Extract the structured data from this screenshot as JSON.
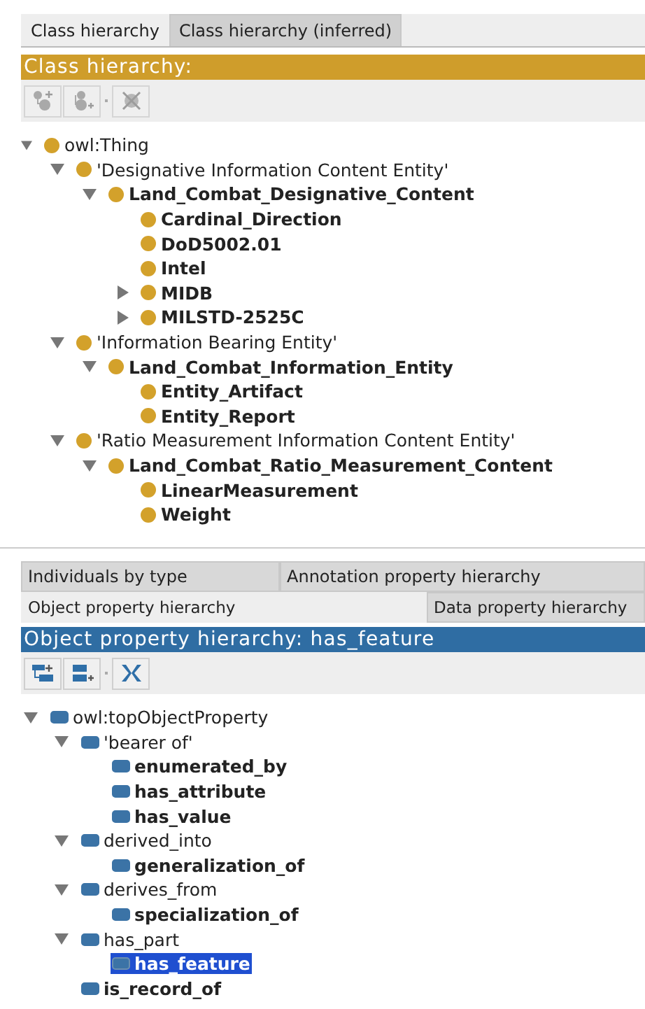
{
  "class_panel": {
    "tabs": [
      {
        "label": "Class hierarchy",
        "selected": true
      },
      {
        "label": "Class hierarchy (inferred)",
        "selected": false
      }
    ],
    "title": "Class hierarchy:",
    "toolbar": [
      {
        "kind": "add-child",
        "disabled": true
      },
      {
        "kind": "add-sibling",
        "disabled": true
      },
      {
        "kind": "delete",
        "disabled": true
      }
    ],
    "tree": [
      {
        "label": "owl:Thing",
        "bold": false,
        "kind": "branch",
        "expanded": true,
        "children": [
          {
            "label": "'Designative Information Content Entity'",
            "bold": false,
            "kind": "branch",
            "expanded": true,
            "children": [
              {
                "label": "Land_Combat_Designative_Content",
                "bold": true,
                "kind": "branch",
                "expanded": true,
                "children": [
                  {
                    "label": "Cardinal_Direction",
                    "bold": true,
                    "kind": "leaf"
                  },
                  {
                    "label": "DoD5002.01",
                    "bold": true,
                    "kind": "leaf"
                  },
                  {
                    "label": "Intel",
                    "bold": true,
                    "kind": "leaf"
                  },
                  {
                    "label": "MIDB",
                    "bold": true,
                    "kind": "branch",
                    "expanded": false
                  },
                  {
                    "label": "MILSTD-2525C",
                    "bold": true,
                    "kind": "branch",
                    "expanded": false
                  }
                ]
              }
            ]
          },
          {
            "label": "'Information Bearing Entity'",
            "bold": false,
            "kind": "branch",
            "expanded": true,
            "children": [
              {
                "label": "Land_Combat_Information_Entity",
                "bold": true,
                "kind": "branch",
                "expanded": true,
                "children": [
                  {
                    "label": "Entity_Artifact",
                    "bold": true,
                    "kind": "leaf"
                  },
                  {
                    "label": "Entity_Report",
                    "bold": true,
                    "kind": "leaf"
                  }
                ]
              }
            ]
          },
          {
            "label": "'Ratio Measurement Information Content Entity'",
            "bold": false,
            "kind": "branch",
            "expanded": true,
            "children": [
              {
                "label": "Land_Combat_Ratio_Measurement_Content",
                "bold": true,
                "kind": "branch",
                "expanded": true,
                "children": [
                  {
                    "label": "LinearMeasurement",
                    "bold": true,
                    "kind": "leaf"
                  },
                  {
                    "label": "Weight",
                    "bold": true,
                    "kind": "leaf"
                  }
                ]
              }
            ]
          }
        ]
      }
    ]
  },
  "property_panel": {
    "tab_rows": [
      [
        {
          "label": "Individuals by type",
          "selected": false
        },
        {
          "label": "Annotation property hierarchy",
          "selected": false
        }
      ],
      [
        {
          "label": "Object property hierarchy",
          "selected": true
        },
        {
          "label": "Data property hierarchy",
          "selected": false
        }
      ]
    ],
    "title": "Object property hierarchy: has_feature",
    "toolbar": [
      {
        "kind": "add-child",
        "disabled": false
      },
      {
        "kind": "add-sibling",
        "disabled": false
      },
      {
        "kind": "delete",
        "disabled": false
      }
    ],
    "tree": [
      {
        "label": "owl:topObjectProperty",
        "bold": false,
        "kind": "branch",
        "expanded": true,
        "selected": false,
        "children": [
          {
            "label": "'bearer of'",
            "bold": false,
            "kind": "branch",
            "expanded": true,
            "selected": false,
            "children": [
              {
                "label": "enumerated_by",
                "bold": true,
                "kind": "leaf",
                "selected": false
              },
              {
                "label": "has_attribute",
                "bold": true,
                "kind": "leaf",
                "selected": false
              },
              {
                "label": "has_value",
                "bold": true,
                "kind": "leaf",
                "selected": false
              }
            ]
          },
          {
            "label": "derived_into",
            "bold": false,
            "kind": "branch",
            "expanded": true,
            "selected": false,
            "children": [
              {
                "label": "generalization_of",
                "bold": true,
                "kind": "leaf",
                "selected": false
              }
            ]
          },
          {
            "label": "derives_from",
            "bold": false,
            "kind": "branch",
            "expanded": true,
            "selected": false,
            "children": [
              {
                "label": "specialization_of",
                "bold": true,
                "kind": "leaf",
                "selected": false
              }
            ]
          },
          {
            "label": "has_part",
            "bold": false,
            "kind": "branch",
            "expanded": true,
            "selected": false,
            "children": [
              {
                "label": "has_feature",
                "bold": true,
                "kind": "leaf",
                "selected": true
              }
            ]
          },
          {
            "label": "is_record_of",
            "bold": true,
            "kind": "leaf",
            "selected": false
          }
        ]
      }
    ]
  }
}
